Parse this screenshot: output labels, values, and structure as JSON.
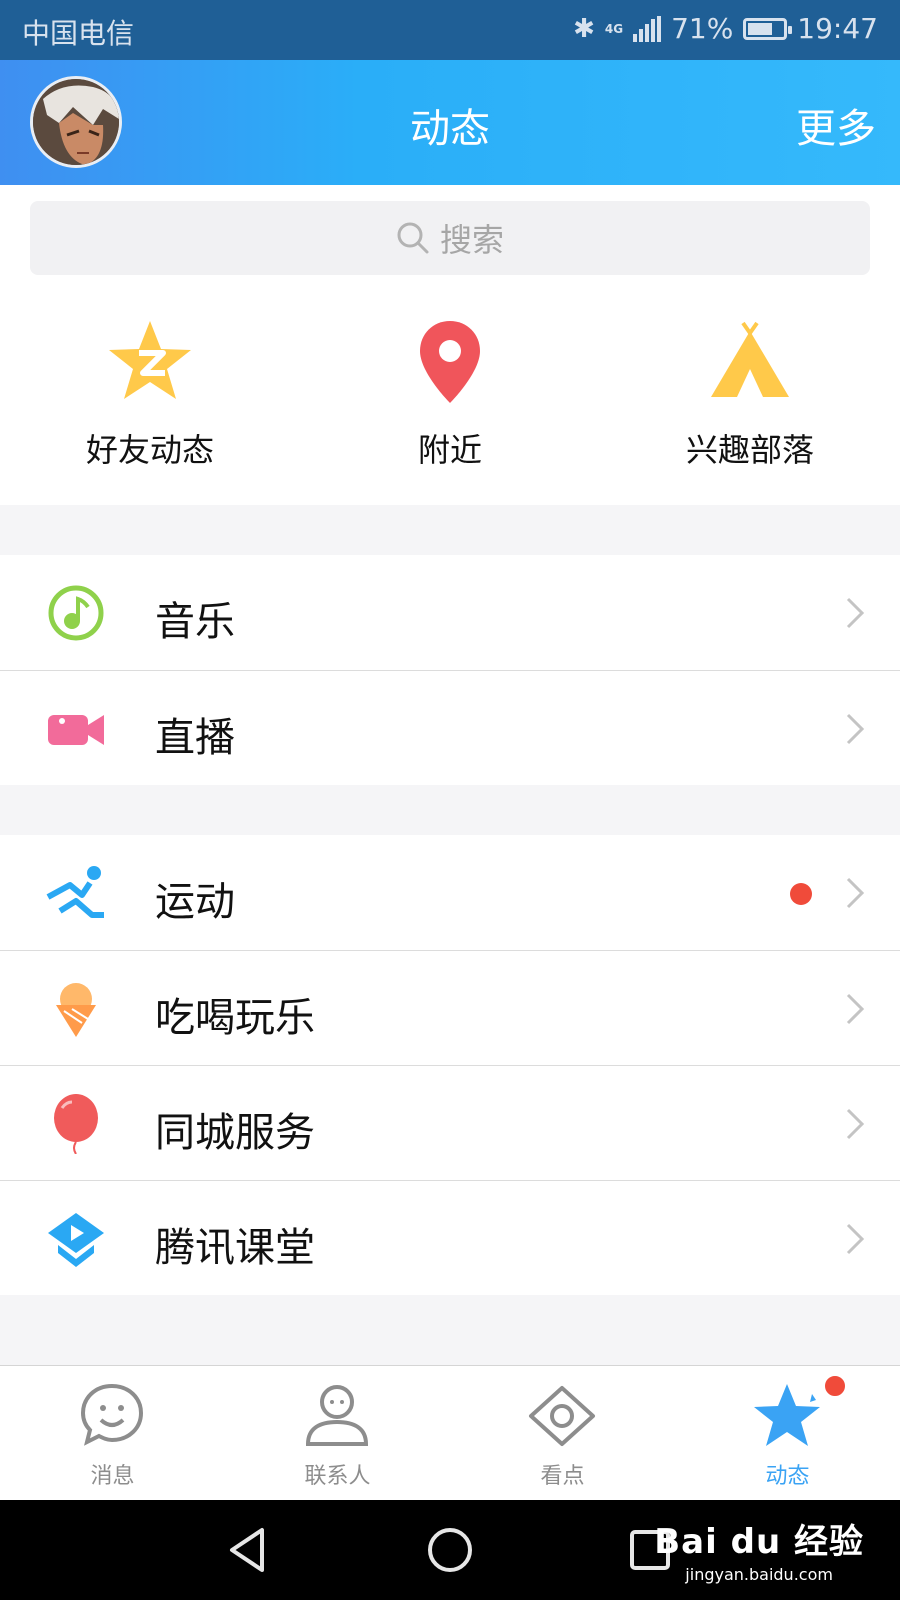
{
  "status_bar": {
    "carrier": "中国电信",
    "network": "4G",
    "battery": "71%",
    "battery_level": 0.71,
    "time": "19:47"
  },
  "header": {
    "title": "动态",
    "more": "更多"
  },
  "search": {
    "placeholder": "搜索"
  },
  "quick_actions": [
    {
      "label": "好友动态",
      "icon": "qzone-star-icon",
      "color": "#ffc94a"
    },
    {
      "label": "附近",
      "icon": "location-pin-icon",
      "color": "#f0555b"
    },
    {
      "label": "兴趣部落",
      "icon": "tent-icon",
      "color": "#ffc94a"
    }
  ],
  "groups": [
    {
      "items": [
        {
          "label": "音乐",
          "icon": "music-icon",
          "color": "#8fd14b",
          "badge": false
        },
        {
          "label": "直播",
          "icon": "video-camera-icon",
          "color": "#f26b9a",
          "badge": false
        }
      ]
    },
    {
      "items": [
        {
          "label": "运动",
          "icon": "running-icon",
          "color": "#2aa8f3",
          "badge": true
        },
        {
          "label": "吃喝玩乐",
          "icon": "ice-cream-icon",
          "color": "#ff9b4a",
          "badge": false
        },
        {
          "label": "同城服务",
          "icon": "balloon-icon",
          "color": "#f05b5b",
          "badge": false
        },
        {
          "label": "腾讯课堂",
          "icon": "classroom-icon",
          "color": "#2aa8f3",
          "badge": false
        }
      ]
    }
  ],
  "tabs": [
    {
      "label": "消息",
      "icon": "chat-bubble-icon",
      "active": false
    },
    {
      "label": "联系人",
      "icon": "person-icon",
      "active": false
    },
    {
      "label": "看点",
      "icon": "eye-icon",
      "active": false
    },
    {
      "label": "动态",
      "icon": "star-icon",
      "active": true,
      "badge": true
    }
  ],
  "nav_buttons": [
    "back-icon",
    "home-icon",
    "recents-icon"
  ],
  "watermark": {
    "logo": "Bai du 经验",
    "url": "jingyan.baidu.com"
  },
  "colors": {
    "header_gradient_start": "#3f8ff1",
    "header_gradient_end": "#35b9fb",
    "status_bar": "#1f5f96",
    "active_tab": "#3aa3f4",
    "badge_red": "#f04b3a"
  }
}
